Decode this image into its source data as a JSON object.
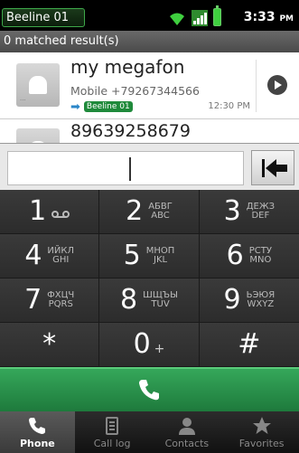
{
  "status_bar": {
    "carrier": "Beeline 01",
    "time": "3:33",
    "ampm": "PM"
  },
  "matched_header": "0 matched result(s)",
  "results": [
    {
      "name": "my megafon",
      "phone": "Mobile +79267344566",
      "sim": "Beeline 01",
      "time": "12:30 PM"
    },
    {
      "name": "89639258679"
    }
  ],
  "dialer": {
    "input_value": ""
  },
  "keypad": [
    {
      "digit": "1",
      "letters": "",
      "icon": "voicemail-icon"
    },
    {
      "digit": "2",
      "letters": "АБВГ\nABC"
    },
    {
      "digit": "3",
      "letters": "ДЕЖЗ\nDEF"
    },
    {
      "digit": "4",
      "letters": "ИЙКЛ\nGHI"
    },
    {
      "digit": "5",
      "letters": "МНОП\nJKL"
    },
    {
      "digit": "6",
      "letters": "РСТУ\nMNO"
    },
    {
      "digit": "7",
      "letters": "ФХЦЧ\nPQRS"
    },
    {
      "digit": "8",
      "letters": "ШЩЪЫ\nTUV"
    },
    {
      "digit": "9",
      "letters": "ЬЭЮЯ\nWXYZ"
    },
    {
      "digit": "*",
      "letters": ""
    },
    {
      "digit": "0",
      "letters": "",
      "sub": "+"
    },
    {
      "digit": "#",
      "letters": ""
    }
  ],
  "tabs": [
    {
      "label": "Phone",
      "icon": "phone-icon",
      "active": true
    },
    {
      "label": "Call log",
      "icon": "call-log-icon",
      "active": false
    },
    {
      "label": "Contacts",
      "icon": "contacts-icon",
      "active": false
    },
    {
      "label": "Favorites",
      "icon": "star-icon",
      "active": false
    }
  ],
  "colors": {
    "call_green": "#2e9a4e",
    "sim_badge": "#1f8a3b"
  }
}
